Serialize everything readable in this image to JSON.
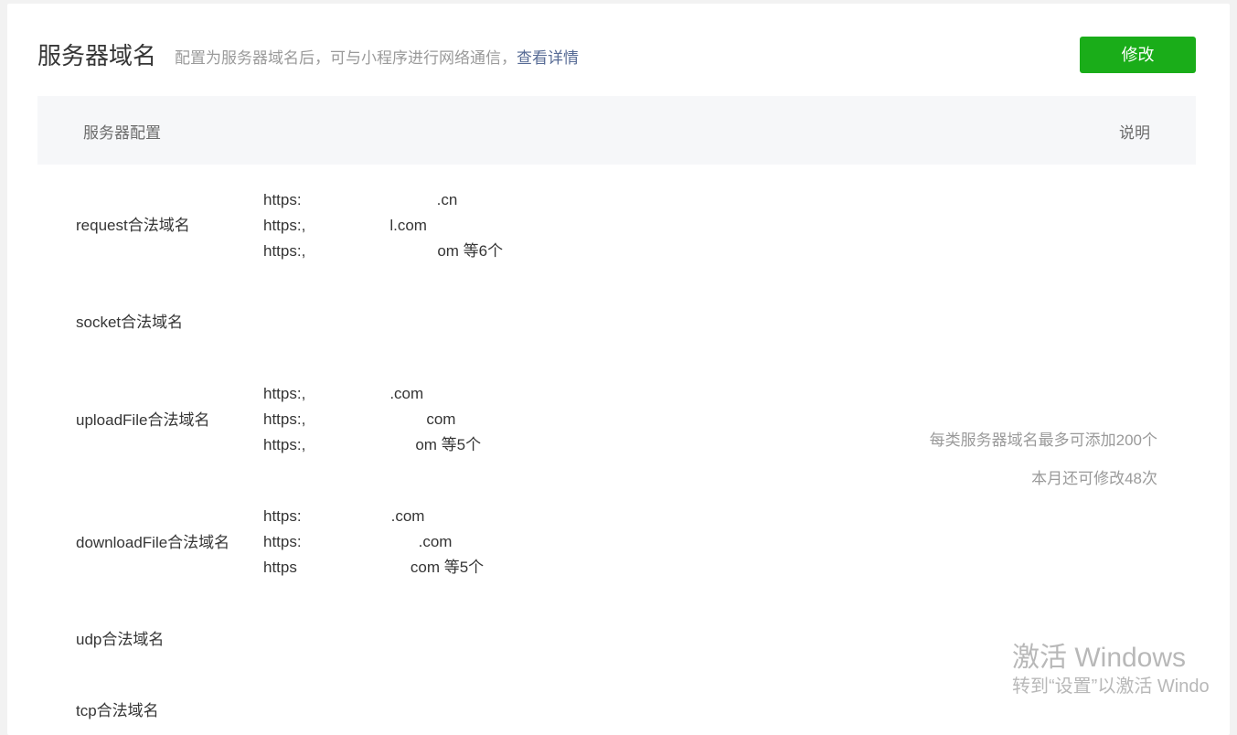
{
  "header": {
    "title": "服务器域名",
    "description": "配置为服务器域名后，可与小程序进行网络通信，",
    "detail_link": "查看详情",
    "edit_button": "修改"
  },
  "table": {
    "col_config": "服务器配置",
    "col_desc": "说明"
  },
  "rows": [
    {
      "label": "request合法域名",
      "values": [
        "https:",
        "https:,",
        "https:,"
      ],
      "suffixes": [
        ".cn",
        "l.com",
        "om 等6个"
      ]
    },
    {
      "label": "socket合法域名",
      "values": [],
      "suffixes": []
    },
    {
      "label": "uploadFile合法域名",
      "values": [
        "https:,",
        "https:,",
        "https:,"
      ],
      "suffixes": [
        ".com",
        "com",
        "om 等5个"
      ]
    },
    {
      "label": "downloadFile合法域名",
      "values": [
        "https:",
        "https:",
        "https"
      ],
      "suffixes": [
        ".com",
        ".com",
        "com 等5个"
      ]
    },
    {
      "label": "udp合法域名",
      "values": [],
      "suffixes": []
    },
    {
      "label": "tcp合法域名",
      "values": [],
      "suffixes": []
    }
  ],
  "notes": {
    "max_domains": "每类服务器域名最多可添加200个",
    "remaining_changes": "本月还可修改48次"
  },
  "watermark": {
    "title": "激活 Windows",
    "subtitle": "转到“设置”以激活 Windo"
  },
  "colors": {
    "accent_green": "#1aad19",
    "link_blue": "#576b95"
  }
}
